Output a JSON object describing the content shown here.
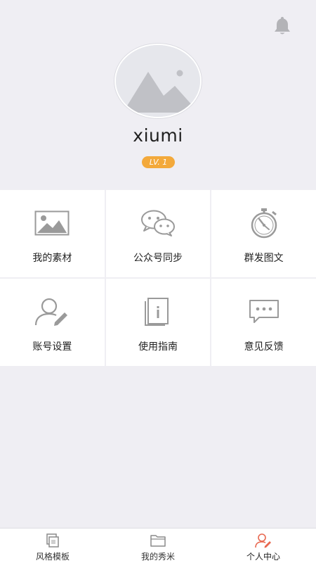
{
  "header": {
    "notification_icon": "bell-icon"
  },
  "profile": {
    "avatar_icon": "image-placeholder-icon",
    "username": "xiumi",
    "level": "LV. 1"
  },
  "menu": [
    {
      "label": "我的素材",
      "icon": "image-icon"
    },
    {
      "label": "公众号同步",
      "icon": "wechat-icon"
    },
    {
      "label": "群发图文",
      "icon": "stopwatch-icon"
    },
    {
      "label": "账号设置",
      "icon": "user-edit-icon"
    },
    {
      "label": "使用指南",
      "icon": "guide-book-icon"
    },
    {
      "label": "意见反馈",
      "icon": "feedback-bubble-icon"
    }
  ],
  "tabs": [
    {
      "label": "风格模板",
      "icon": "template-icon",
      "active": false
    },
    {
      "label": "我的秀米",
      "icon": "folder-icon",
      "active": false
    },
    {
      "label": "个人中心",
      "icon": "profile-icon",
      "active": true
    }
  ],
  "colors": {
    "background": "#efeef3",
    "badge": "#f3a93b",
    "icon_gray": "#9a9a9a",
    "active_accent": "#e8674f"
  }
}
